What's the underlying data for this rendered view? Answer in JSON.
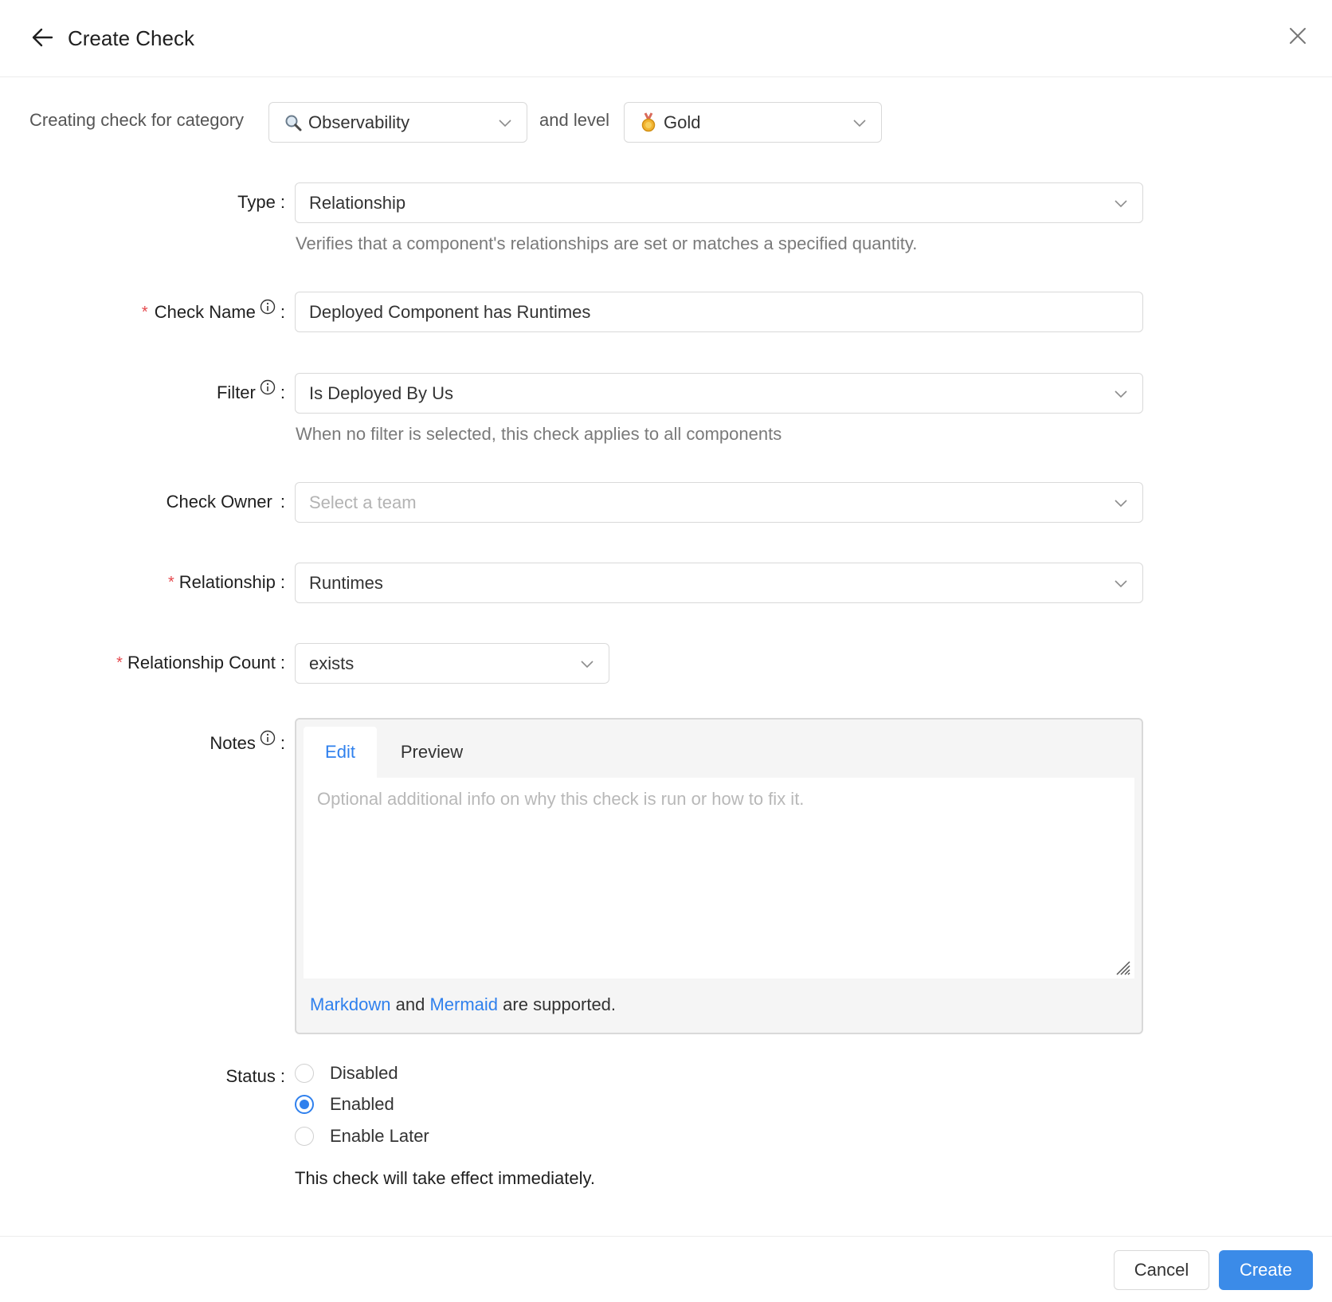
{
  "header": {
    "title": "Create Check",
    "back_icon": "arrow-left-icon",
    "close_icon": "close-icon"
  },
  "category_row": {
    "prefix": "Creating check for category",
    "category_value": "Observability",
    "category_icon": "magnifying-glass-icon",
    "joiner": "and level",
    "level_value": "Gold",
    "level_icon": "gold-medal-icon"
  },
  "form": {
    "type": {
      "label": "Type",
      "value": "Relationship",
      "help": "Verifies that a component's relationships are set or matches a specified quantity."
    },
    "check_name": {
      "label": "Check Name",
      "required": true,
      "value": "Deployed Component has Runtimes"
    },
    "filter": {
      "label": "Filter",
      "value": "Is Deployed By Us",
      "help": "When no filter is selected, this check applies to all components"
    },
    "check_owner": {
      "label": "Check Owner",
      "placeholder": "Select a team"
    },
    "relationship": {
      "label": "Relationship",
      "required": true,
      "value": "Runtimes"
    },
    "relationship_count": {
      "label": "Relationship Count",
      "required": true,
      "value": "exists"
    },
    "notes": {
      "label": "Notes",
      "tabs": [
        {
          "label": "Edit",
          "active": true
        },
        {
          "label": "Preview",
          "active": false
        }
      ],
      "placeholder": "Optional additional info on why this check is run or how to fix it.",
      "footer_link1": "Markdown",
      "footer_and": "and",
      "footer_link2": "Mermaid",
      "footer_suffix": "are supported."
    },
    "status": {
      "label": "Status",
      "options": [
        {
          "label": "Disabled",
          "selected": false
        },
        {
          "label": "Enabled",
          "selected": true
        },
        {
          "label": "Enable Later",
          "selected": false
        }
      ],
      "note": "This check will take effect immediately."
    }
  },
  "footer": {
    "cancel_label": "Cancel",
    "create_label": "Create"
  },
  "colors": {
    "primary": "#3b8be8",
    "link": "#2f80ed",
    "required": "#e5484d",
    "border": "#d9d9d9"
  }
}
